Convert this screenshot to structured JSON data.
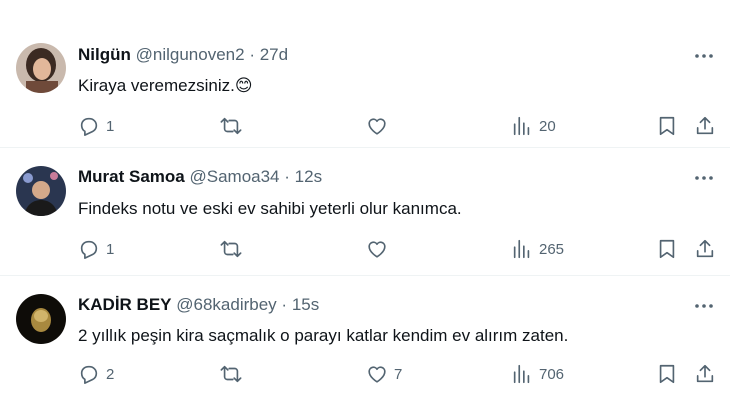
{
  "tweets": [
    {
      "name": "Nilgün",
      "handle": "@nilgunoven2",
      "separator": "·",
      "time": "27d",
      "text": "Kiraya veremezsiniz.",
      "emoji": "😊",
      "replies": "1",
      "retweets": "",
      "likes": "",
      "views": "20"
    },
    {
      "name": "Murat Samoa",
      "handle": "@Samoa34",
      "separator": "·",
      "time": "12s",
      "text": "Findeks notu ve eski ev sahibi yeterli olur kanımca.",
      "emoji": "",
      "replies": "1",
      "retweets": "",
      "likes": "",
      "views": "265"
    },
    {
      "name": "KADİR BEY",
      "handle": "@68kadirbey",
      "separator": "·",
      "time": "15s",
      "text": "2 yıllık peşin kira saçmalık o parayı katlar kendim ev alırım zaten.",
      "emoji": "",
      "replies": "2",
      "retweets": "",
      "likes": "7",
      "views": "706"
    }
  ],
  "colors": {
    "text": "#0f1419",
    "secondary": "#536471",
    "divider": "#eff3f4"
  },
  "icons": [
    "more-icon",
    "reply-icon",
    "retweet-icon",
    "like-icon",
    "views-icon",
    "bookmark-icon",
    "share-icon"
  ]
}
